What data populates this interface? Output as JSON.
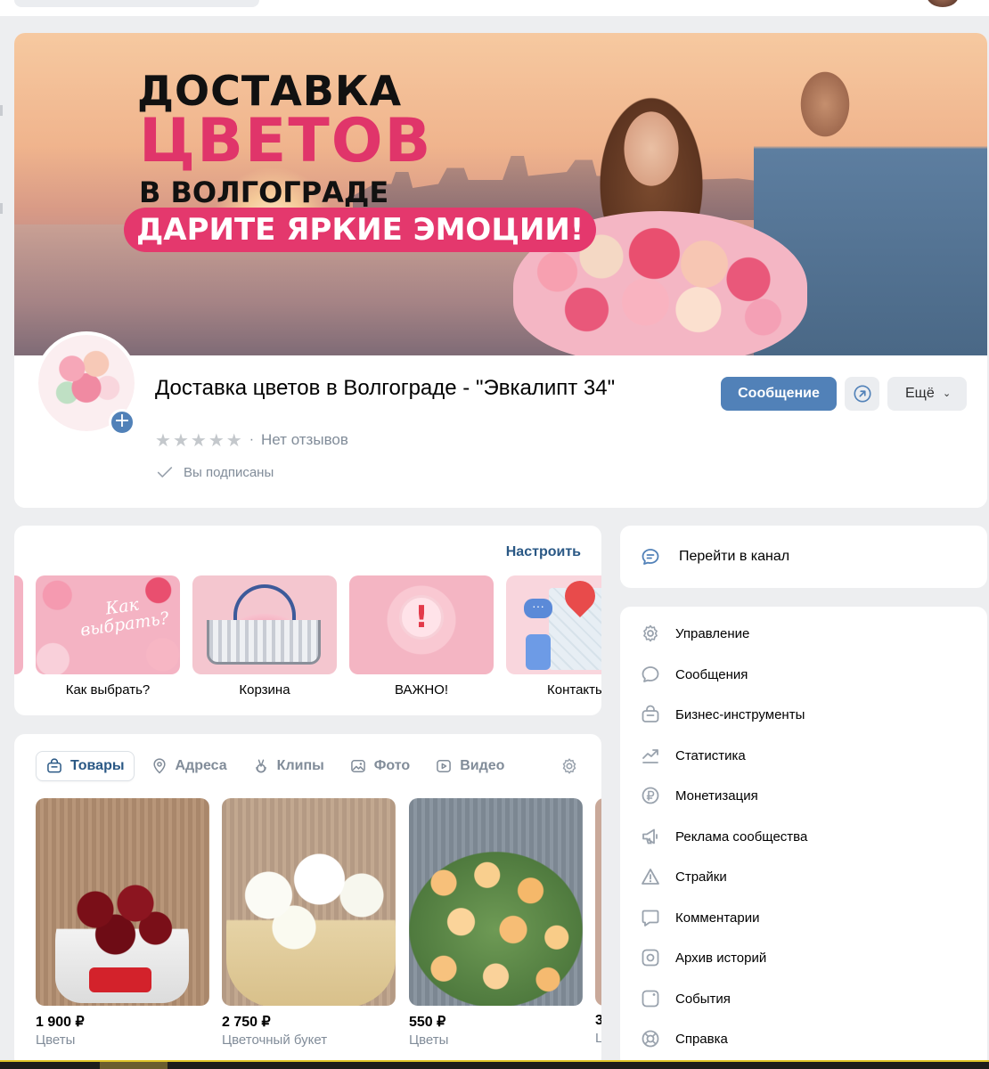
{
  "cover": {
    "line1": "ДОСТАВКА",
    "line2": "ЦВЕТОВ",
    "line3": "В ВОЛГОГРАДЕ",
    "line4": "ДАРИТЕ ЯРКИЕ ЭМОЦИИ!"
  },
  "profile": {
    "title": "Доставка цветов в Волгограде - \"Эвкалипт 34\"",
    "rating_stars": 0,
    "reviews": "Нет отзывов",
    "subscribed": "Вы подписаны",
    "message_button": "Сообщение",
    "more_button": "Ещё"
  },
  "shortcuts": {
    "configure": "Настроить",
    "tiles": [
      {
        "label": "Как выбрать?",
        "image_text": "Как выбрать?"
      },
      {
        "label": "Корзина"
      },
      {
        "label": "ВАЖНО!"
      },
      {
        "label": "Контакты"
      }
    ]
  },
  "products_tabs": {
    "tabs": [
      {
        "label": "Товары",
        "icon": "bag-icon",
        "active": true
      },
      {
        "label": "Адреса",
        "icon": "location-pin-icon"
      },
      {
        "label": "Клипы",
        "icon": "clips-icon"
      },
      {
        "label": "Фото",
        "icon": "photo-icon"
      },
      {
        "label": "Видео",
        "icon": "video-icon"
      }
    ]
  },
  "products": [
    {
      "price": "1 900 ₽",
      "category": "Цветы"
    },
    {
      "price": "2 750 ₽",
      "category": "Цветочный букет"
    },
    {
      "price": "550 ₽",
      "category": "Цветы"
    },
    {
      "price": "3",
      "category": "Ц"
    }
  ],
  "channel": {
    "label": "Перейти в канал"
  },
  "menu": {
    "items": [
      {
        "label": "Управление",
        "icon": "gear-icon"
      },
      {
        "label": "Сообщения",
        "icon": "chat-bubble-icon"
      },
      {
        "label": "Бизнес-инструменты",
        "icon": "briefcase-icon"
      },
      {
        "label": "Статистика",
        "icon": "trend-chart-icon"
      },
      {
        "label": "Монетизация",
        "icon": "ruble-coin-icon"
      },
      {
        "label": "Реклама сообщества",
        "icon": "megaphone-icon"
      },
      {
        "label": "Страйки",
        "icon": "warning-triangle-icon"
      },
      {
        "label": "Комментарии",
        "icon": "comment-icon"
      },
      {
        "label": "Архив историй",
        "icon": "stories-archive-icon"
      },
      {
        "label": "События",
        "icon": "calendar-icon"
      },
      {
        "label": "Справка",
        "icon": "help-lifebuoy-icon"
      }
    ]
  },
  "colors": {
    "accent": "#5181b8",
    "link": "#2a5885",
    "cover_pink": "#e0356a",
    "muted": "#818c99",
    "background": "#edeef0"
  }
}
